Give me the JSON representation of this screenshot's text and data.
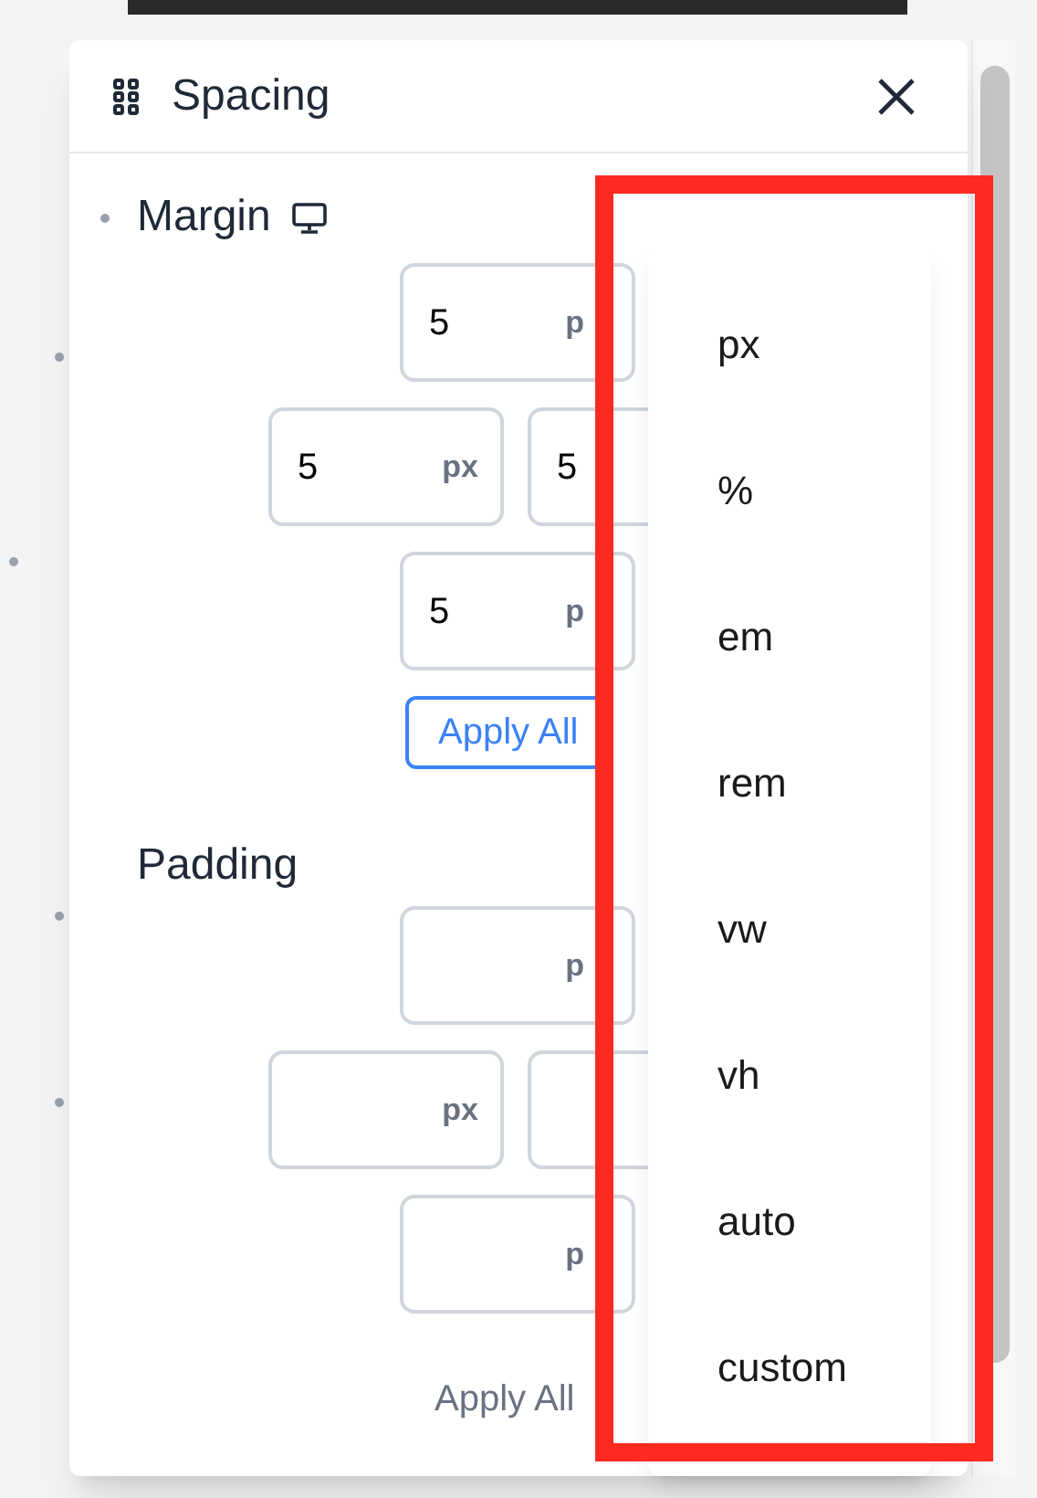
{
  "panel": {
    "title": "Spacing"
  },
  "sections": [
    {
      "label": "Margin",
      "responsive": true,
      "bullet": true,
      "fields": [
        {
          "kind": "top",
          "value": "5",
          "unit": "p"
        },
        {
          "kind": "left",
          "value": "5",
          "unit": "px"
        },
        {
          "kind": "right",
          "value": "5"
        },
        {
          "kind": "bottom",
          "value": "5",
          "unit": "p"
        }
      ],
      "apply_button": {
        "label": "Apply All",
        "disabled": false
      }
    },
    {
      "label": "Padding",
      "responsive": false,
      "bullet": false,
      "fields": [
        {
          "kind": "top",
          "unit": "p"
        },
        {
          "kind": "left",
          "unit": "px"
        },
        {
          "kind": "right"
        },
        {
          "kind": "bottom",
          "unit": "p"
        }
      ],
      "apply_button": {
        "label": "Apply All",
        "disabled": true
      }
    }
  ],
  "unit_menu": {
    "options": [
      "px",
      "%",
      "em",
      "rem",
      "vw",
      "vh",
      "auto",
      "custom"
    ]
  }
}
